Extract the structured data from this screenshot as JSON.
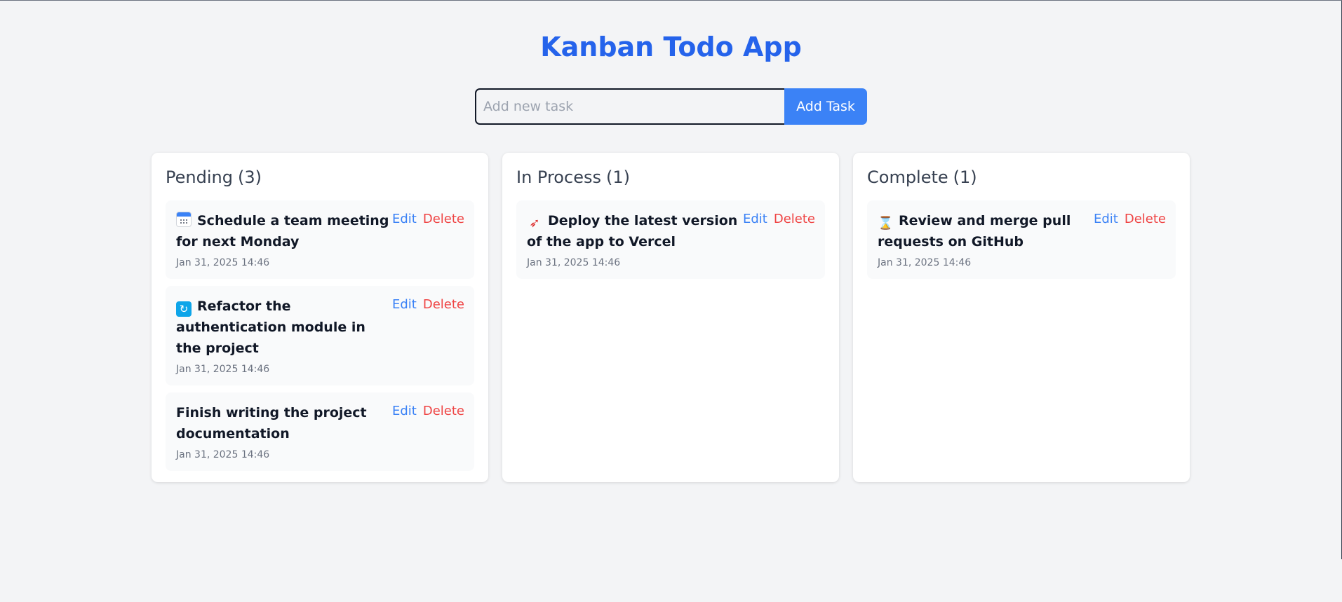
{
  "app": {
    "title": "Kanban Todo App"
  },
  "add_bar": {
    "placeholder": "Add new task",
    "value": "",
    "button_label": "Add Task"
  },
  "actions": {
    "edit_label": "Edit",
    "delete_label": "Delete"
  },
  "columns": [
    {
      "title": "Pending",
      "count": "(3)",
      "cards": [
        {
          "icon": "calendar-icon",
          "text": "Schedule a team meeting for next Monday",
          "date": "Jan 31, 2025 14:46"
        },
        {
          "icon": "refresh-icon",
          "text": "Refactor the authentication module in the project",
          "date": "Jan 31, 2025 14:46"
        },
        {
          "icon": "",
          "text": "Finish writing the project documentation",
          "date": "Jan 31, 2025 14:46"
        }
      ]
    },
    {
      "title": "In Process",
      "count": "(1)",
      "cards": [
        {
          "icon": "rocket-icon",
          "text": "Deploy the latest version of the app to Vercel",
          "date": "Jan 31, 2025 14:46"
        }
      ]
    },
    {
      "title": "Complete",
      "count": "(1)",
      "cards": [
        {
          "icon": "hourglass-icon",
          "text": "Review and merge pull requests on GitHub",
          "date": "Jan 31, 2025 14:46"
        }
      ]
    }
  ],
  "colors": {
    "accent": "#2563eb",
    "button": "#3b82f6",
    "edit": "#3b82f6",
    "delete": "#ef4444",
    "background": "#f3f4f6"
  }
}
